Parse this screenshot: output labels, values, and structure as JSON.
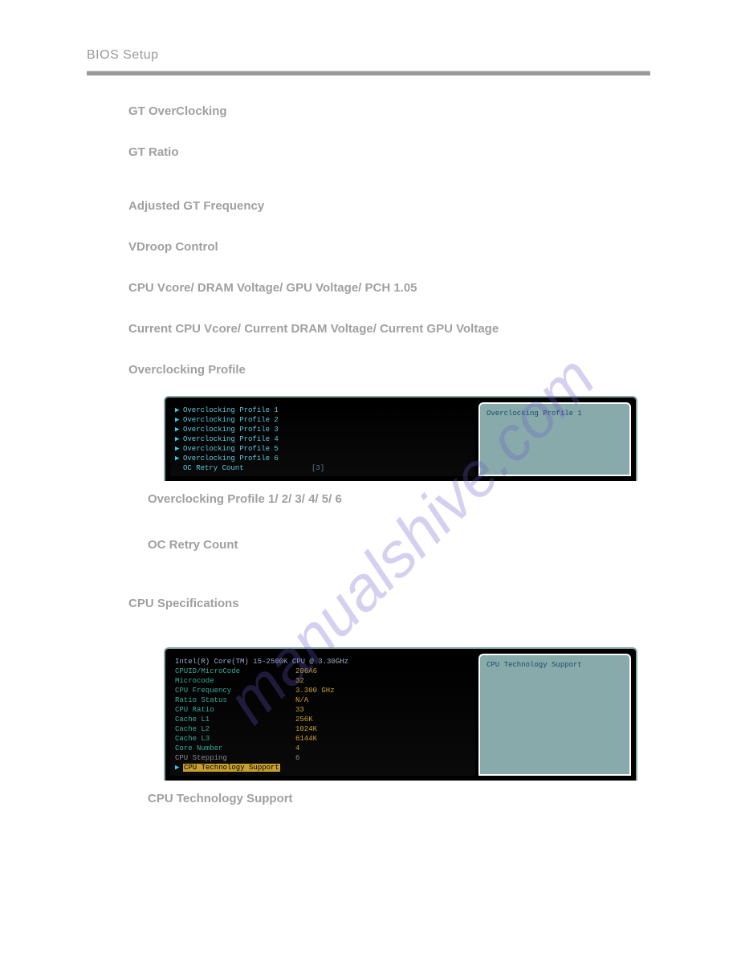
{
  "header": {
    "title": "BIOS Setup"
  },
  "headings": {
    "gt_overclocking": "GT OverClocking",
    "gt_ratio": "GT Ratio",
    "adjusted_gt_freq": "Adjusted GT Frequency",
    "vdroop_control": "VDroop Control",
    "cpu_voltage": "CPU Vcore/ DRAM Voltage/ GPU Voltage/ PCH 1.05",
    "current_voltage": "Current CPU Vcore/ Current DRAM Voltage/ Current GPU Voltage",
    "oc_profile": "Overclocking Profile",
    "oc_profile_n": "Overclocking Profile 1/ 2/ 3/ 4/ 5/ 6",
    "oc_retry": "OC Retry Count",
    "cpu_spec": "CPU Specifications",
    "cpu_tech": "CPU Technology Support"
  },
  "oc_screenshot": {
    "rows": [
      {
        "label": "Overclocking Profile 1"
      },
      {
        "label": "Overclocking Profile 2"
      },
      {
        "label": "Overclocking Profile 3"
      },
      {
        "label": "Overclocking Profile 4"
      },
      {
        "label": "Overclocking Profile 5"
      },
      {
        "label": "Overclocking Profile 6"
      }
    ],
    "retry_label": "OC Retry Count",
    "retry_val": "[3]",
    "side_text": "Overclocking Profile 1"
  },
  "cpu_screenshot": {
    "title": "Intel(R) Core(TM) i5-2500K CPU @ 3.30GHz",
    "rows": [
      {
        "label": "CPUID/MicroCode",
        "val": "206A6"
      },
      {
        "label": "Microcode",
        "val": "32"
      },
      {
        "label": "CPU Frequency",
        "val": "3.300 GHz"
      },
      {
        "label": "Ratio Status",
        "val": "N/A"
      },
      {
        "label": "CPU Ratio",
        "val": "33"
      },
      {
        "label": "Cache L1",
        "val": "256K"
      },
      {
        "label": "Cache L2",
        "val": "1024K"
      },
      {
        "label": "Cache L3",
        "val": "6144K"
      },
      {
        "label": "Core Number",
        "val": "4"
      },
      {
        "label": "CPU Stepping",
        "val": "6"
      }
    ],
    "tech_label": "CPU Technology Support",
    "side_text": "CPU Technology Support"
  },
  "watermark": {
    "text": "manualshive.com"
  }
}
